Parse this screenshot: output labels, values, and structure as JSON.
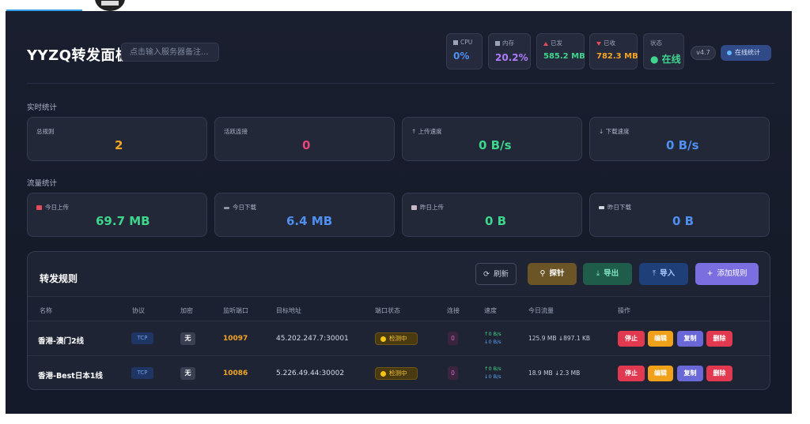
{
  "header": {
    "brand": "YYZQ转发面板",
    "note_placeholder": "点击输入服务器备注...",
    "stats": {
      "cpu": {
        "label": "CPU",
        "value": "0%"
      },
      "mem": {
        "label": "内存",
        "value": "20.2%"
      },
      "sent": {
        "label": "已发",
        "value": "585.2 MB"
      },
      "recv": {
        "label": "已收",
        "value": "782.3 MB"
      },
      "status": {
        "label": "状态",
        "value": "在线"
      }
    },
    "version": "v4.7",
    "online_button": "在线统计"
  },
  "realtime": {
    "section_label": "实时统计",
    "cards": [
      {
        "label": "总规则",
        "value": "2"
      },
      {
        "label": "活跃连接",
        "value": "0"
      },
      {
        "label": "上传速度",
        "value": "0 B/s"
      },
      {
        "label": "下载速度",
        "value": "0 B/s"
      }
    ]
  },
  "traffic": {
    "section_label": "流量统计",
    "cards": [
      {
        "label": "今日上传",
        "value": "69.7 MB"
      },
      {
        "label": "今日下载",
        "value": "6.4 MB"
      },
      {
        "label": "昨日上传",
        "value": "0 B"
      },
      {
        "label": "昨日下载",
        "value": "0 B"
      }
    ]
  },
  "rules": {
    "title": "转发规则",
    "buttons": {
      "refresh": "刷新",
      "probe": "探针",
      "export": "导出",
      "import": "导入",
      "add": "添加规则"
    },
    "columns": [
      "名称",
      "协议",
      "加密",
      "监听端口",
      "目标地址",
      "端口状态",
      "连接",
      "速度",
      "今日流量",
      "操作"
    ],
    "rows": [
      {
        "name": "香港-澳门2线",
        "protocol": "TCP",
        "encryption": "无",
        "port": "10097",
        "target": "45.202.247.7:30001",
        "port_status": "检测中",
        "connections": "0",
        "speed_up": "↑0 B/s",
        "speed_down": "↓0 B/s",
        "traffic": "125.9 MB ↓897.1 KB"
      },
      {
        "name": "香港-Best日本1线",
        "protocol": "TCP",
        "encryption": "无",
        "port": "10086",
        "target": "5.226.49.44:30002",
        "port_status": "检测中",
        "connections": "0",
        "speed_up": "↑0 B/s",
        "speed_down": "↓0 B/s",
        "traffic": "18.9 MB ↓2.3 MB"
      }
    ],
    "actions": {
      "stop": "停止",
      "edit": "编辑",
      "copy": "复制",
      "delete": "删除"
    }
  },
  "colors": {
    "background": "#161b2a",
    "card": "#222838",
    "orange": "#f5a524",
    "pink": "#e8457c",
    "green": "#3dd68c",
    "blue": "#4f8ff0",
    "purple": "#b07cff"
  }
}
